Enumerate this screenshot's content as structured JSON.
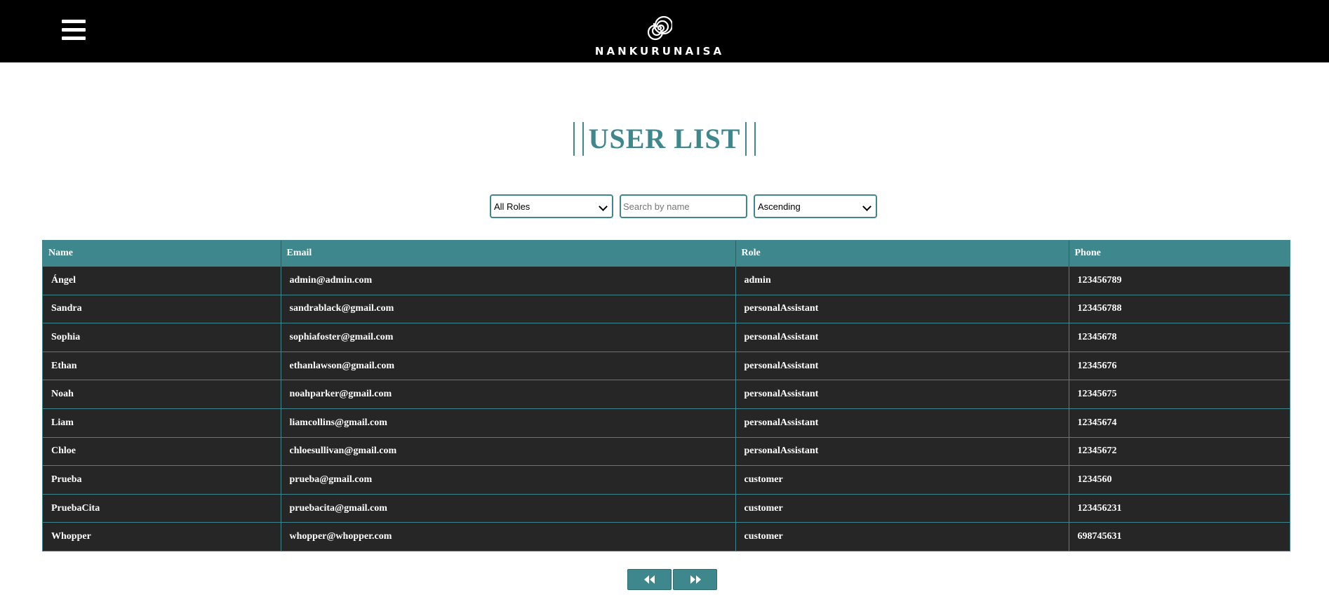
{
  "header": {
    "brand_name": "NANKURUNAISA",
    "menu_icon": "hamburger-menu-icon",
    "logo_icon": "spiral-logo-icon"
  },
  "page": {
    "title": "USER LIST"
  },
  "filters": {
    "role_select_value": "All Roles",
    "search_placeholder": "Search by name",
    "order_select_value": "Ascending"
  },
  "table": {
    "columns": [
      "Name",
      "Email",
      "Role",
      "Phone"
    ],
    "rows": [
      {
        "name": "Ángel",
        "email": "admin@admin.com",
        "role": "admin",
        "phone": "123456789"
      },
      {
        "name": "Sandra",
        "email": "sandrablack@gmail.com",
        "role": "personalAssistant",
        "phone": "123456788"
      },
      {
        "name": "Sophia",
        "email": "sophiafoster@gmail.com",
        "role": "personalAssistant",
        "phone": "12345678"
      },
      {
        "name": "Ethan",
        "email": "ethanlawson@gmail.com",
        "role": "personalAssistant",
        "phone": "12345676"
      },
      {
        "name": "Noah",
        "email": "noahparker@gmail.com",
        "role": "personalAssistant",
        "phone": "12345675"
      },
      {
        "name": "Liam",
        "email": "liamcollins@gmail.com",
        "role": "personalAssistant",
        "phone": "12345674"
      },
      {
        "name": "Chloe",
        "email": "chloesullivan@gmail.com",
        "role": "personalAssistant",
        "phone": "12345672"
      },
      {
        "name": "Prueba",
        "email": "prueba@gmail.com",
        "role": "customer",
        "phone": "1234560"
      },
      {
        "name": "PruebaCita",
        "email": "pruebacita@gmail.com",
        "role": "customer",
        "phone": "123456231"
      },
      {
        "name": "Whopper",
        "email": "whopper@whopper.com",
        "role": "customer",
        "phone": "698745631"
      }
    ]
  },
  "pagination": {
    "prev_icon": "double-chevron-left-icon",
    "next_icon": "double-chevron-right-icon"
  },
  "colors": {
    "accent": "#3e878d",
    "navbar": "#000000",
    "table_body": "#262626"
  }
}
